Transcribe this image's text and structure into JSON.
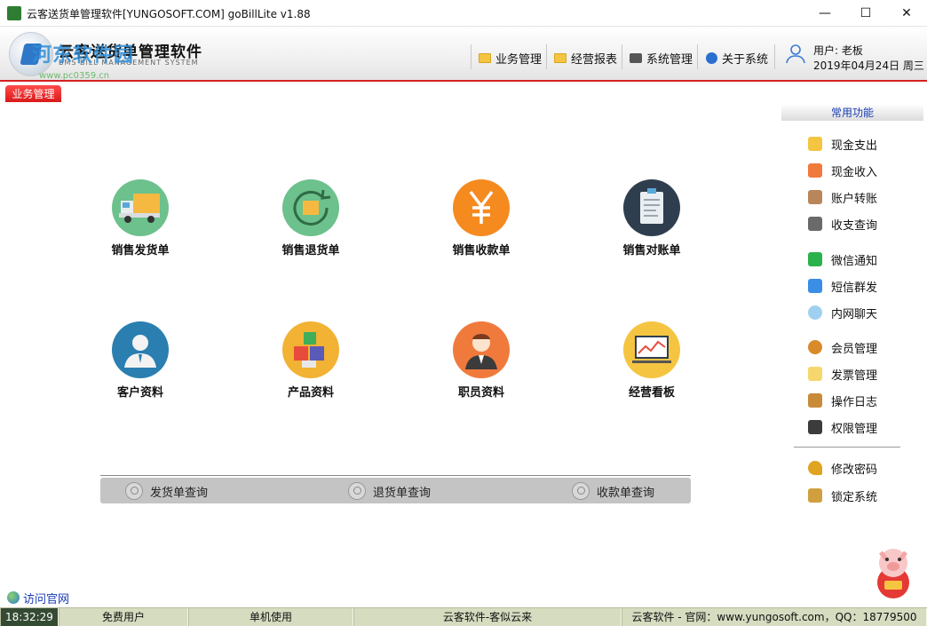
{
  "window": {
    "title": "云客送货单管理软件[YUNGOSOFT.COM]  goBillLite v1.88",
    "controls": {
      "minimize": "—",
      "maximize": "☐",
      "close": "✕"
    }
  },
  "header": {
    "brand_cn": "云客送货单管理软件",
    "brand_en": "BMS BILL MANAGEMENT SYSTEM",
    "watermark": "河东软件园",
    "watermark_sub": "www.pc0359.cn",
    "menu": [
      {
        "label": "业务管理",
        "icon": "folder-icon"
      },
      {
        "label": "经营报表",
        "icon": "folder-icon"
      },
      {
        "label": "系统管理",
        "icon": "settings-icon"
      },
      {
        "label": "关于系统",
        "icon": "help-icon"
      }
    ],
    "user_label": "用户: 老板",
    "date_label": "2019年04月24日 周三"
  },
  "tab": {
    "label": "业务管理"
  },
  "tiles": [
    {
      "label": "销售发货单",
      "icon": "truck-icon",
      "color": "#6cc18c"
    },
    {
      "label": "销售退货单",
      "icon": "return-box-icon",
      "color": "#6cc18c"
    },
    {
      "label": "销售收款单",
      "icon": "yen-icon",
      "color": "#f58a1f"
    },
    {
      "label": "销售对账单",
      "icon": "clipboard-icon",
      "color": "#2f3e4f"
    },
    {
      "label": "客户资料",
      "icon": "customer-icon",
      "color": "#2a7fb0"
    },
    {
      "label": "产品资料",
      "icon": "products-icon",
      "color": "#f2b233"
    },
    {
      "label": "职员资料",
      "icon": "staff-icon",
      "color": "#f07a3c"
    },
    {
      "label": "经营看板",
      "icon": "dashboard-icon",
      "color": "#f5c542"
    }
  ],
  "queries": [
    {
      "label": "发货单查询"
    },
    {
      "label": "退货单查询"
    },
    {
      "label": "收款单查询"
    }
  ],
  "side": {
    "title": "常用功能",
    "items": [
      {
        "label": "现金支出",
        "icon": "cash-out-icon",
        "color": "#f5c542"
      },
      {
        "label": "现金收入",
        "icon": "cash-in-icon",
        "color": "#f07a3c"
      },
      {
        "label": "账户转账",
        "icon": "transfer-icon",
        "color": "#b9855a"
      },
      {
        "label": "收支查询",
        "icon": "query-icon",
        "color": "#6a6a6a"
      },
      {
        "label": "微信通知",
        "icon": "wechat-icon",
        "color": "#2bb24c"
      },
      {
        "label": "短信群发",
        "icon": "sms-icon",
        "color": "#3a8ee6"
      },
      {
        "label": "内网聊天",
        "icon": "chat-icon",
        "color": "#9fd0f0"
      },
      {
        "label": "会员管理",
        "icon": "member-icon",
        "color": "#d98a2a"
      },
      {
        "label": "发票管理",
        "icon": "invoice-icon",
        "color": "#f5d76e"
      },
      {
        "label": "操作日志",
        "icon": "log-icon",
        "color": "#c98a3a"
      },
      {
        "label": "权限管理",
        "icon": "monitor-icon",
        "color": "#3c3c3c"
      },
      {
        "label": "修改密码",
        "icon": "key-icon",
        "color": "#e0a420"
      },
      {
        "label": "锁定系统",
        "icon": "lock-icon",
        "color": "#d0a040"
      }
    ]
  },
  "footer_link": {
    "label": "访问官网"
  },
  "status": {
    "time": "18:32:29",
    "user_type": "免费用户",
    "mode": "单机使用",
    "slogan": "云客软件-客似云来",
    "site": "云客软件 - 官网：www.yungosoft.com，QQ：18779500"
  }
}
